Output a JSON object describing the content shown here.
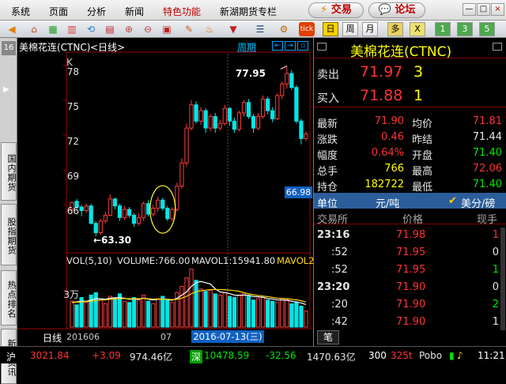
{
  "menu": {
    "items": [
      "系统",
      "页面",
      "分析",
      "新闻",
      "特色功能",
      "新湖期货专栏"
    ],
    "trade_label": "交易",
    "forum_label": "论坛"
  },
  "toolbar": {
    "periods": [
      "日",
      "周",
      "月",
      "多",
      "X",
      "1",
      "3",
      "5"
    ],
    "active_period": "日",
    "tick_label": "tick"
  },
  "left_tabs": [
    "国内期货",
    "股指期货",
    "热点排名",
    "新闻资讯"
  ],
  "left_tab_top": "16",
  "chart": {
    "title": "美棉花连(CTNC)",
    "period_label": "<日线>",
    "view_label": "周期",
    "k_label": "K",
    "high_label": "77.95",
    "low_label": "←63.30",
    "price_marker": "66.98",
    "volume_legend": {
      "vol": "VOL(5,10)",
      "volume": "VOLUME:766.00",
      "mavol1": "MAVOL1:15941.80",
      "mavol2": "MAVOL2"
    },
    "volume_tick": "3万",
    "xaxis": {
      "label": "日线",
      "d1": "201606",
      "d2": "07",
      "cursor_date": "2016-07-13(三)"
    }
  },
  "chart_data": {
    "type": "candlestick",
    "title": "美棉花连(CTNC)",
    "ylim": [
      62,
      79
    ],
    "yticks": [
      66,
      69,
      72,
      75,
      78
    ],
    "high": 77.95,
    "low": 63.3,
    "last": 66.98,
    "candles": [
      [
        65.6,
        66.2,
        65.2,
        66.3
      ],
      [
        66.3,
        65.8,
        65.6,
        66.5
      ],
      [
        65.8,
        65.5,
        65.0,
        66.0
      ],
      [
        65.5,
        65.9,
        65.3,
        66.1
      ],
      [
        65.9,
        64.4,
        64.3,
        66.1
      ],
      [
        64.4,
        63.6,
        63.3,
        64.6
      ],
      [
        63.6,
        64.6,
        63.4,
        64.8
      ],
      [
        64.6,
        65.1,
        64.4,
        65.4
      ],
      [
        65.1,
        66.5,
        65.0,
        66.9
      ],
      [
        66.5,
        65.9,
        65.6,
        66.6
      ],
      [
        65.9,
        64.9,
        64.6,
        66.1
      ],
      [
        64.9,
        65.6,
        64.7,
        65.9
      ],
      [
        65.6,
        65.1,
        64.9,
        65.8
      ],
      [
        65.1,
        64.4,
        64.1,
        65.3
      ],
      [
        64.4,
        64.9,
        64.2,
        65.3
      ],
      [
        64.9,
        66.1,
        64.6,
        66.3
      ],
      [
        66.1,
        65.2,
        65.0,
        66.4
      ],
      [
        65.2,
        65.7,
        65.0,
        66.0
      ],
      [
        65.7,
        66.4,
        65.4,
        66.7
      ],
      [
        66.4,
        65.7,
        65.5,
        66.6
      ],
      [
        65.7,
        64.8,
        64.6,
        65.9
      ],
      [
        64.8,
        65.6,
        64.6,
        65.8
      ],
      [
        65.6,
        67.6,
        65.4,
        67.9
      ],
      [
        67.6,
        69.6,
        67.4,
        70.0
      ],
      [
        69.6,
        72.6,
        69.3,
        73.0
      ],
      [
        72.6,
        74.6,
        72.4,
        75.0
      ],
      [
        74.6,
        73.2,
        73.0,
        74.9
      ],
      [
        73.2,
        74.1,
        72.9,
        74.4
      ],
      [
        74.1,
        72.6,
        72.2,
        74.3
      ],
      [
        72.6,
        73.6,
        72.3,
        73.8
      ],
      [
        73.6,
        72.6,
        72.2,
        73.9
      ],
      [
        72.6,
        73.0,
        72.4,
        73.3
      ],
      [
        73.0,
        74.3,
        72.8,
        74.6
      ],
      [
        74.3,
        73.2,
        72.8,
        74.4
      ],
      [
        73.2,
        72.5,
        72.2,
        73.5
      ],
      [
        72.5,
        73.9,
        72.3,
        74.1
      ],
      [
        73.9,
        74.8,
        73.6,
        75.0
      ],
      [
        74.8,
        73.6,
        73.4,
        75.1
      ],
      [
        73.6,
        72.6,
        72.2,
        73.8
      ],
      [
        72.6,
        73.6,
        72.4,
        73.9
      ],
      [
        73.6,
        75.1,
        73.4,
        75.4
      ],
      [
        75.1,
        74.1,
        73.8,
        75.3
      ],
      [
        74.1,
        73.4,
        73.1,
        74.4
      ],
      [
        73.4,
        75.4,
        73.3,
        75.6
      ],
      [
        75.4,
        76.4,
        75.1,
        76.6
      ],
      [
        76.4,
        77.3,
        76.0,
        77.95
      ],
      [
        77.3,
        76.1,
        75.9,
        77.6
      ],
      [
        76.1,
        73.2,
        73.0,
        76.3
      ],
      [
        73.2,
        71.7,
        71.2,
        73.4
      ],
      [
        71.7,
        72.1,
        71.5,
        72.3
      ]
    ],
    "volume_ylim": [
      0,
      50000
    ],
    "volume_tick": 30000,
    "volumes": [
      21000,
      18000,
      24000,
      20000,
      26000,
      28000,
      22000,
      19000,
      25000,
      23000,
      27000,
      21000,
      20000,
      24000,
      22000,
      26000,
      21000,
      19000,
      23000,
      25000,
      22000,
      20000,
      28000,
      33000,
      40000,
      47000,
      38000,
      31000,
      29000,
      30000,
      27000,
      26000,
      28000,
      25000,
      24000,
      26000,
      27000,
      25000,
      22000,
      23000,
      24000,
      22000,
      21000,
      20000,
      23000,
      22000,
      19000,
      20000,
      17000,
      13000
    ],
    "mavol1": [
      20000,
      20500,
      21000,
      21000,
      21800,
      23200,
      23000,
      22600,
      23500,
      23800,
      24000,
      23400,
      22600,
      22900,
      22500,
      23600,
      22600,
      22000,
      22600,
      22800,
      22400,
      21800,
      23400,
      26000,
      28600,
      33000,
      36000,
      37000,
      36000,
      35000,
      31000,
      28600,
      28000,
      27200,
      26000,
      25800,
      26000,
      25800,
      24800,
      24600,
      24200,
      23200,
      22800,
      22000,
      22000,
      21800,
      21000,
      20400,
      19600,
      18300
    ],
    "mavol2": [
      20000,
      20200,
      20500,
      20700,
      21000,
      21600,
      22000,
      22100,
      22600,
      22900,
      23000,
      23200,
      23000,
      23100,
      23000,
      23300,
      23000,
      22700,
      22800,
      22700,
      22600,
      22300,
      22600,
      23500,
      25000,
      27000,
      28800,
      29500,
      30000,
      30500,
      30500,
      30500,
      30300,
      30000,
      29600,
      29000,
      28000,
      27000,
      26200,
      25700,
      25200,
      24700,
      24100,
      23400,
      23300,
      23000,
      22600,
      22100,
      21400,
      20300
    ]
  },
  "quote": {
    "title": "美棉花连(CTNC)",
    "sell": {
      "label": "卖出",
      "price": "71.97",
      "qty": "3"
    },
    "buy": {
      "label": "买入",
      "price": "71.88",
      "qty": "1"
    },
    "rows": [
      {
        "l1": "最新",
        "v1": "71.90",
        "c1": "red",
        "l2": "均价",
        "v2": "71.81",
        "c2": "red"
      },
      {
        "l1": "涨跌",
        "v1": "0.46",
        "c1": "red",
        "l2": "昨结",
        "v2": "71.44",
        "c2": "white"
      },
      {
        "l1": "幅度",
        "v1": "0.64%",
        "c1": "red",
        "l2": "开盘",
        "v2": "71.40",
        "c2": "green"
      },
      {
        "l1": "总手",
        "v1": "766",
        "c1": "yellow",
        "l2": "最高",
        "v2": "72.06",
        "c2": "red"
      },
      {
        "l1": "持仓",
        "v1": "182722",
        "c1": "yellow",
        "l2": "最低",
        "v2": "71.40",
        "c2": "green"
      }
    ],
    "unit_label": "单位",
    "unit_value": "元/吨",
    "unit_option": "美分/磅",
    "ticks_header": {
      "c1": "交易所",
      "c2": "价格",
      "c3": "现手"
    },
    "ticks": [
      {
        "time": "23:16",
        "price": "71.98",
        "qty": "1",
        "qc": "red"
      },
      {
        "time": ":52",
        "price": "71.95",
        "qty": "0",
        "qc": "white"
      },
      {
        "time": ":52",
        "price": "71.95",
        "qty": "1",
        "qc": "green"
      },
      {
        "time": "23:20",
        "price": "71.90",
        "qty": "0",
        "qc": "white"
      },
      {
        "time": ":20",
        "price": "71.90",
        "qty": "2",
        "qc": "green"
      },
      {
        "time": ":42",
        "price": "71.90",
        "qty": "1",
        "qc": "white"
      }
    ],
    "tab_label": "笔"
  },
  "status": {
    "sh_label": "沪",
    "sh_index": "3021.84",
    "sh_change": "+3.09",
    "sh_amount": "974.46亿",
    "sz_label": "深",
    "sz_index": "10478.59",
    "sz_change": "-32.56",
    "sz_amount": "1470.63亿",
    "cy": "300",
    "cy_val": "325t",
    "brand": "Pobo",
    "clock": "11:21"
  }
}
